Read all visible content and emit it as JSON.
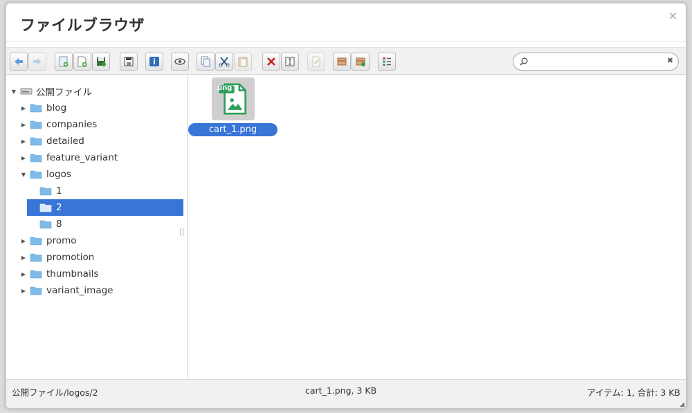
{
  "dialog": {
    "title": "ファイルブラウザ",
    "close_label": "×"
  },
  "toolbar": {
    "groups": [
      [
        "back-icon",
        "forward-icon"
      ],
      [
        "new-folder-icon",
        "new-file-icon",
        "upload-icon"
      ],
      [
        "save-icon"
      ],
      [
        "info-icon"
      ],
      [
        "preview-icon"
      ],
      [
        "copy-icon",
        "cut-icon",
        "paste-icon"
      ],
      [
        "delete-icon",
        "rename-icon"
      ],
      [
        "edit-icon"
      ],
      [
        "extract-icon",
        "archive-icon"
      ],
      [
        "view-list-icon"
      ]
    ]
  },
  "search": {
    "value": "",
    "placeholder": "",
    "clear_label": "✖"
  },
  "tree": {
    "root_label": "公開ファイル",
    "items": [
      {
        "label": "blog",
        "level": 1,
        "expanded": false
      },
      {
        "label": "companies",
        "level": 1,
        "expanded": false
      },
      {
        "label": "detailed",
        "level": 1,
        "expanded": false
      },
      {
        "label": "feature_variant",
        "level": 1,
        "expanded": false
      },
      {
        "label": "logos",
        "level": 1,
        "expanded": true
      },
      {
        "label": "1",
        "level": 2,
        "expanded": false
      },
      {
        "label": "2",
        "level": 2,
        "expanded": false,
        "selected": true
      },
      {
        "label": "8",
        "level": 2,
        "expanded": false
      },
      {
        "label": "promo",
        "level": 1,
        "expanded": false
      },
      {
        "label": "promotion",
        "level": 1,
        "expanded": false
      },
      {
        "label": "thumbnails",
        "level": 1,
        "expanded": false
      },
      {
        "label": "variant_image",
        "level": 1,
        "expanded": false
      }
    ]
  },
  "files": [
    {
      "name": "cart_1.png",
      "badge": "png",
      "selected": true
    }
  ],
  "status": {
    "path": "公開ファイル/logos/2",
    "selection": "cart_1.png, 3 KB",
    "summary": "アイテム: 1, 合計: 3 KB"
  },
  "colors": {
    "selection": "#3875d7",
    "file_icon_green": "#2e9e5b"
  }
}
